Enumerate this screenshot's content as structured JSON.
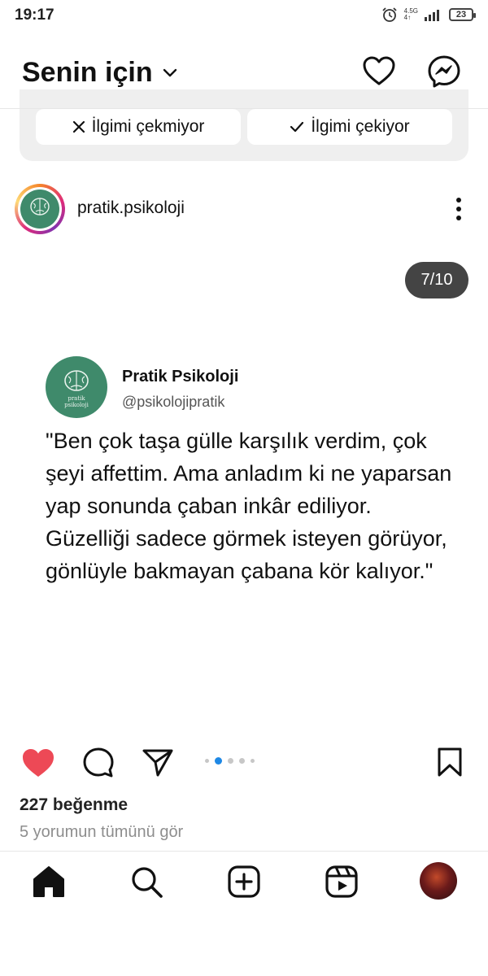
{
  "status_bar": {
    "time": "19:17",
    "network_label_top": "4.5G",
    "network_label_bottom": "4↑",
    "battery": "23"
  },
  "header": {
    "title": "Senin için",
    "icons": [
      "chevron-down-icon",
      "heart-icon",
      "messenger-icon"
    ]
  },
  "suggestion": {
    "not_interested_label": "İlgimi çekmiyor",
    "interested_label": "İlgimi çekiyor"
  },
  "post": {
    "username": "pratik.psikoloji",
    "page_counter": "7/10",
    "quote": {
      "name": "Pratik Psikoloji",
      "handle": "@psikolojipratik",
      "text": "\"Ben çok taşa gülle karşılık verdim, çok şeyi affettim. Ama anladım ki ne yaparsan yap sonunda çaban inkâr ediliyor. Güzelliği sadece görmek isteyen görüyor, gönlüyle bakmayan çabana kör kalıyor.\"",
      "avatar_caption_1": "pratik",
      "avatar_caption_2": "psikoloji"
    },
    "carousel": {
      "dot_count": 5,
      "active_index": 1
    },
    "liked": true,
    "likes_label": "227 beğenme",
    "comments_label": "5 yorumun tümünü gör"
  },
  "colors": {
    "like_red": "#ed4956",
    "avatar_green": "#3f8a6b",
    "dot_active": "#1e88e5",
    "counter_bg": "#444444"
  },
  "bottom_nav": {
    "items": [
      "home-icon",
      "search-icon",
      "create-icon",
      "reels-icon",
      "profile-avatar"
    ]
  }
}
